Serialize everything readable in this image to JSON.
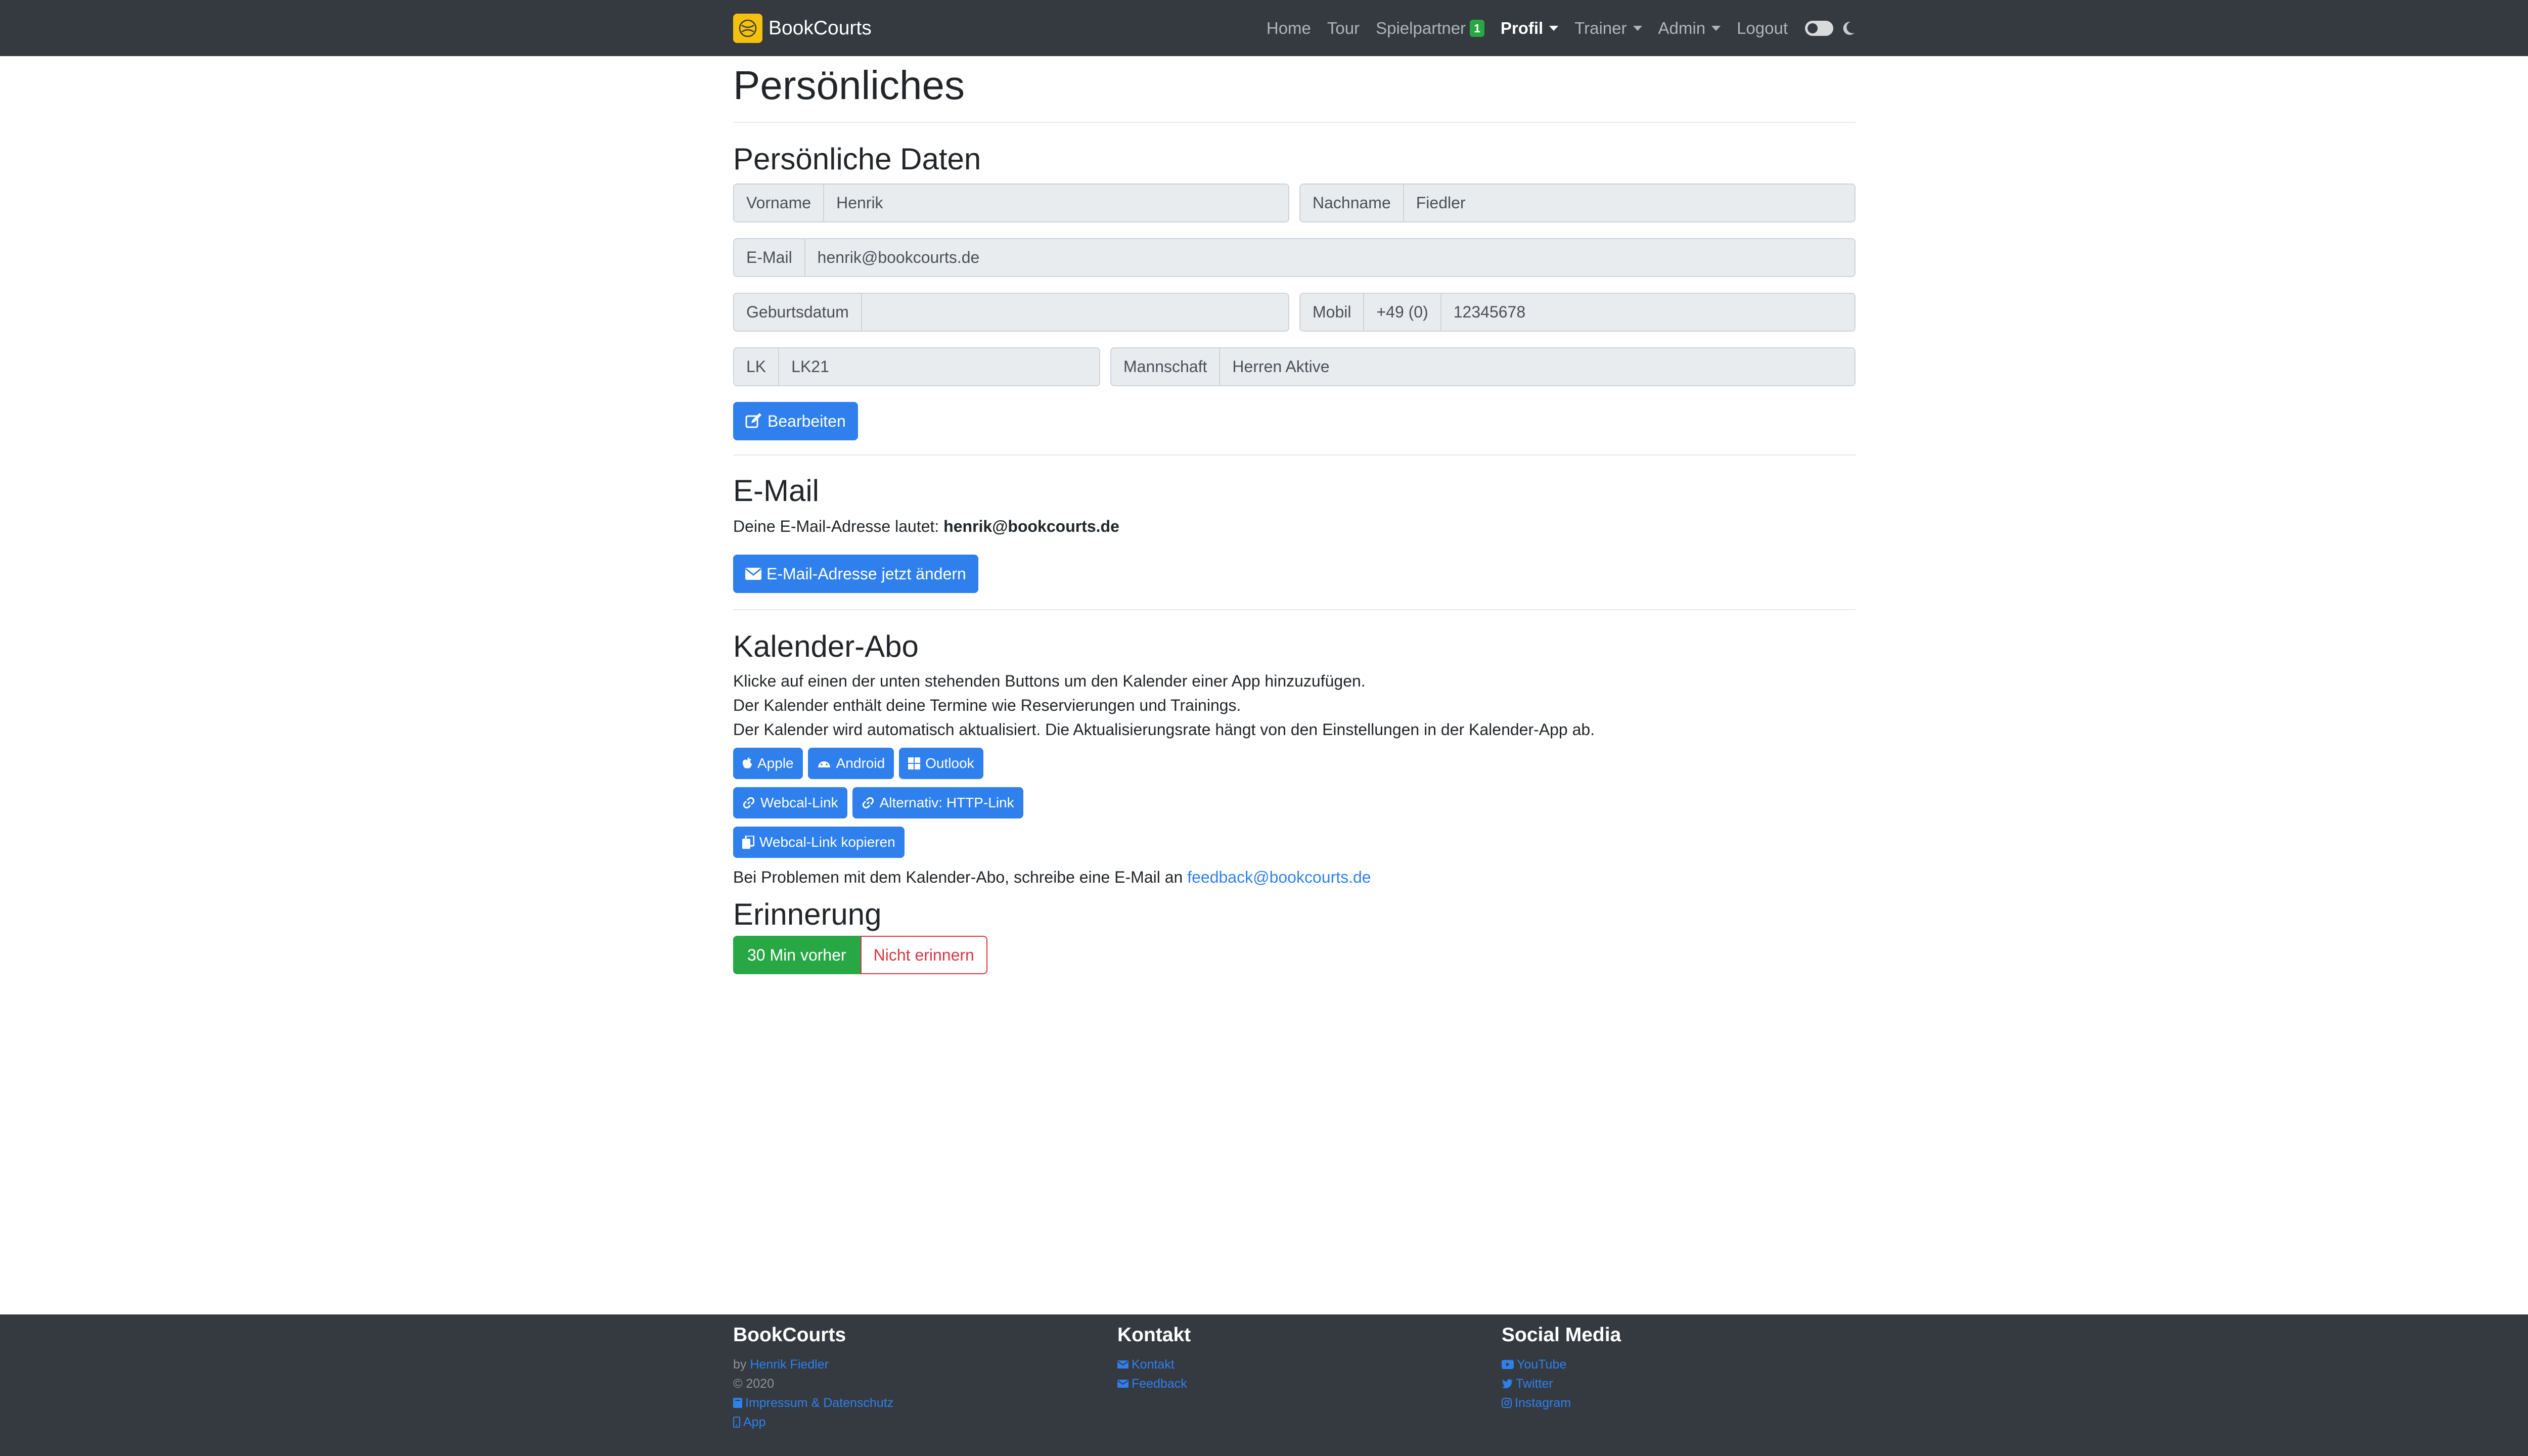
{
  "navbar": {
    "brand": "BookCourts",
    "links": {
      "home": "Home",
      "tour": "Tour",
      "spielpartner": "Spielpartner",
      "spielpartner_badge": "1",
      "profil": "Profil",
      "trainer": "Trainer",
      "admin": "Admin",
      "logout": "Logout"
    }
  },
  "page": {
    "title": "Persönliches"
  },
  "personal": {
    "heading": "Persönliche Daten",
    "vorname_label": "Vorname",
    "vorname": "Henrik",
    "nachname_label": "Nachname",
    "nachname": "Fiedler",
    "email_label": "E-Mail",
    "email": "henrik@bookcourts.de",
    "geburtsdatum_label": "Geburtsdatum",
    "geburtsdatum": "",
    "mobil_label": "Mobil",
    "mobil_prefix": "+49 (0)",
    "mobil": "12345678",
    "lk_label": "LK",
    "lk": "LK21",
    "mannschaft_label": "Mannschaft",
    "mannschaft": "Herren Aktive",
    "edit_button": "Bearbeiten"
  },
  "email_section": {
    "heading": "E-Mail",
    "text_prefix": "Deine E-Mail-Adresse lautet: ",
    "address": "henrik@bookcourts.de",
    "change_button": "E-Mail-Adresse jetzt ändern"
  },
  "calendar": {
    "heading": "Kalender-Abo",
    "line1": "Klicke auf einen der unten stehenden Buttons um den Kalender einer App hinzuzufügen.",
    "line2": "Der Kalender enthält deine Termine wie Reservierungen und Trainings.",
    "line3": "Der Kalender wird automatisch aktualisiert. Die Aktualisierungsrate hängt von den Einstellungen in der Kalender-App ab.",
    "apple": "Apple",
    "android": "Android",
    "outlook": "Outlook",
    "webcal": "Webcal-Link",
    "http": "Alternativ: HTTP-Link",
    "copy": "Webcal-Link kopieren",
    "problem_text": "Bei Problemen mit dem Kalender-Abo, schreibe eine E-Mail an ",
    "problem_email": "feedback@bookcourts.de"
  },
  "reminder": {
    "heading": "Erinnerung",
    "option_30": "30 Min vorher",
    "option_none": "Nicht erinnern"
  },
  "footer": {
    "col1": {
      "title": "BookCourts",
      "by_prefix": "by ",
      "author": "Henrik Fiedler",
      "copyright": "© 2020",
      "impressum": "Impressum & Datenschutz",
      "app": "App"
    },
    "col2": {
      "title": "Kontakt",
      "kontakt": "Kontakt",
      "feedback": "Feedback"
    },
    "col3": {
      "title": "Social Media",
      "youtube": "YouTube",
      "twitter": "Twitter",
      "instagram": "Instagram"
    }
  },
  "colors": {
    "navbar_bg": "#343a40",
    "primary": "#2f80ed",
    "success": "#28a745",
    "danger": "#dc3545"
  }
}
